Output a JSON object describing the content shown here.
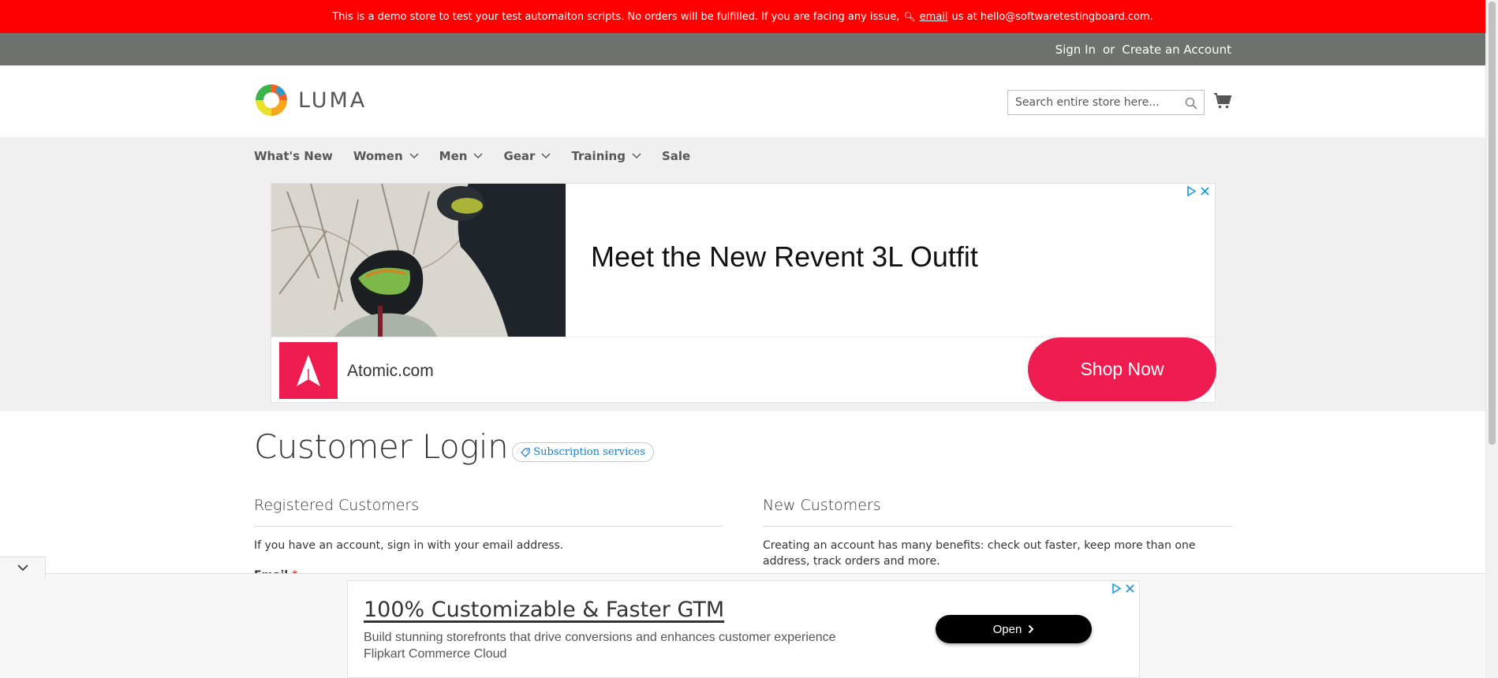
{
  "demo_banner": {
    "text_before": "This is a demo store to test your test automaiton scripts. No orders will be fulfilled. If you are facing any issue,",
    "link_text": "email",
    "text_after": "us at hello@softwaretestingboard.com."
  },
  "header": {
    "sign_in": "Sign In",
    "or": "or",
    "create_account": "Create an Account",
    "logo_text": "LUMA",
    "search_placeholder": "Search entire store here..."
  },
  "nav": {
    "items": [
      {
        "label": "What's New",
        "has_dropdown": false
      },
      {
        "label": "Women",
        "has_dropdown": true
      },
      {
        "label": "Men",
        "has_dropdown": true
      },
      {
        "label": "Gear",
        "has_dropdown": true
      },
      {
        "label": "Training",
        "has_dropdown": true
      },
      {
        "label": "Sale",
        "has_dropdown": false
      }
    ]
  },
  "ad_top": {
    "headline": "Meet the New Revent 3L Outfit",
    "brand": "Atomic.com",
    "cta": "Shop Now",
    "brand_color": "#ef1c4f"
  },
  "login": {
    "title": "Customer Login",
    "badge": "Subscription services",
    "registered": {
      "title": "Registered Customers",
      "text": "If you have an account, sign in with your email address.",
      "email_label": "Email",
      "required_mark": "*"
    },
    "new_customers": {
      "title": "New Customers",
      "text": "Creating an account has many benefits: check out faster, keep more than one address, track orders and more."
    }
  },
  "sticky_ad": {
    "headline": "100% Customizable & Faster GTM",
    "line1": "Build stunning storefronts that drive conversions and enhances customer experience",
    "line2": "Flipkart Commerce Cloud",
    "cta": "Open"
  },
  "colors": {
    "banner_red": "#ff0000",
    "panel_gray": "#6e716e",
    "link_blue": "#1979c3",
    "nav_bg": "#f0f0f0"
  }
}
